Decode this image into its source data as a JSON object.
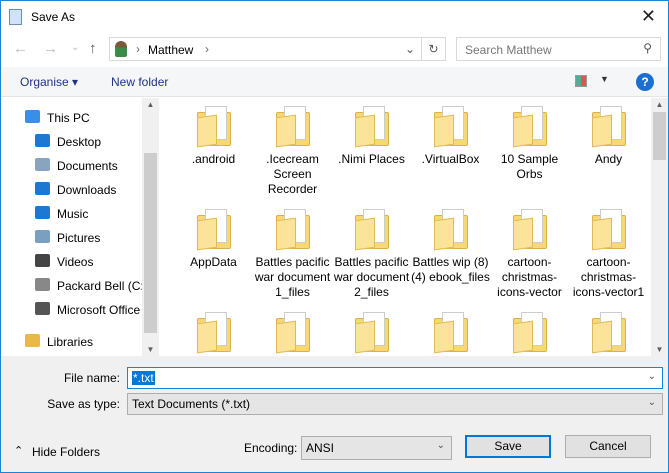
{
  "window": {
    "title": "Save As",
    "close": "✕"
  },
  "nav": {
    "back": "←",
    "forward": "→",
    "recent": "⌄",
    "up": "↑",
    "path": "Matthew",
    "sep": "›",
    "dropdown": "⌄",
    "refresh": "↻",
    "search_placeholder": "Search Matthew",
    "search_icon": "⚲"
  },
  "toolbar": {
    "organise": "Organise ▾",
    "new_folder": "New folder",
    "view_dropdown": "▼",
    "help": "?"
  },
  "sidebar": {
    "items": [
      {
        "label": "This PC",
        "color": "#3a8ee6"
      },
      {
        "label": "Desktop",
        "color": "#1e78d2"
      },
      {
        "label": "Documents",
        "color": "#8aa4c0"
      },
      {
        "label": "Downloads",
        "color": "#1e78d2"
      },
      {
        "label": "Music",
        "color": "#1e78d2"
      },
      {
        "label": "Pictures",
        "color": "#7aa0c0"
      },
      {
        "label": "Videos",
        "color": "#444"
      },
      {
        "label": "Packard Bell (C:)",
        "color": "#888"
      },
      {
        "label": "Microsoft Office",
        "color": "#555"
      },
      {
        "label": "Libraries",
        "color": "#e8b84a"
      }
    ]
  },
  "files": [
    {
      "name": ".android"
    },
    {
      "name": ".Icecream Screen Recorder"
    },
    {
      "name": ".Nimi Places"
    },
    {
      "name": ".VirtualBox"
    },
    {
      "name": "10 Sample Orbs"
    },
    {
      "name": "Andy"
    },
    {
      "name": "AppData"
    },
    {
      "name": "Battles pacific war document 1_files"
    },
    {
      "name": "Battles pacific war document 2_files"
    },
    {
      "name": "Battles wip (8) (4) ebook_files"
    },
    {
      "name": "cartoon-christmas-icons-vector"
    },
    {
      "name": "cartoon-christmas-icons-vector1"
    },
    {
      "name": ""
    },
    {
      "name": ""
    },
    {
      "name": ""
    },
    {
      "name": ""
    },
    {
      "name": ""
    },
    {
      "name": ""
    }
  ],
  "form": {
    "file_name_label": "File name:",
    "file_name_value": "*.txt",
    "save_type_label": "Save as type:",
    "save_type_value": "Text Documents (*.txt)",
    "encoding_label": "Encoding:",
    "encoding_value": "ANSI",
    "chevron": "⌄"
  },
  "footer": {
    "hide_folders": "Hide Folders",
    "hide_icon": "⌃",
    "save": "Save",
    "cancel": "Cancel"
  }
}
